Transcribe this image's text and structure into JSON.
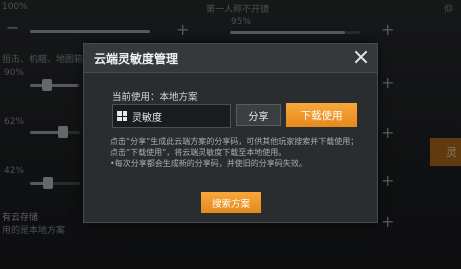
{
  "background": {
    "top_left_label": "100%",
    "top_mid_label": "第一人称不开镜",
    "top_right_label": "仰",
    "mid_pct": "95%",
    "row2_text": "狙击、机瞄、地图箱等",
    "pct_90": "90%",
    "pct_62": "62%",
    "pct_42": "42%",
    "cloud_label": "有云存储",
    "cloud_sub": "用的是本地方案",
    "orange_tab": "灵"
  },
  "modal": {
    "title": "云端灵敏度管理",
    "current_label": "当前使用：本地方案",
    "plan_name": "灵敏度",
    "share_label": "分享",
    "download_label": "下载使用",
    "desc_lines": [
      "点击“分享”生成此云端方案的分享码，可供其他玩家搜索并下载使用；",
      "点击“下载使用”，将云端灵敏度下载至本地使用。",
      "•每次分享都会生成新的分享码，并使旧的分享码失效。"
    ],
    "search_label": "搜索方案"
  },
  "icons": {
    "close": "close-icon",
    "plan": "windows-grid-icon"
  }
}
